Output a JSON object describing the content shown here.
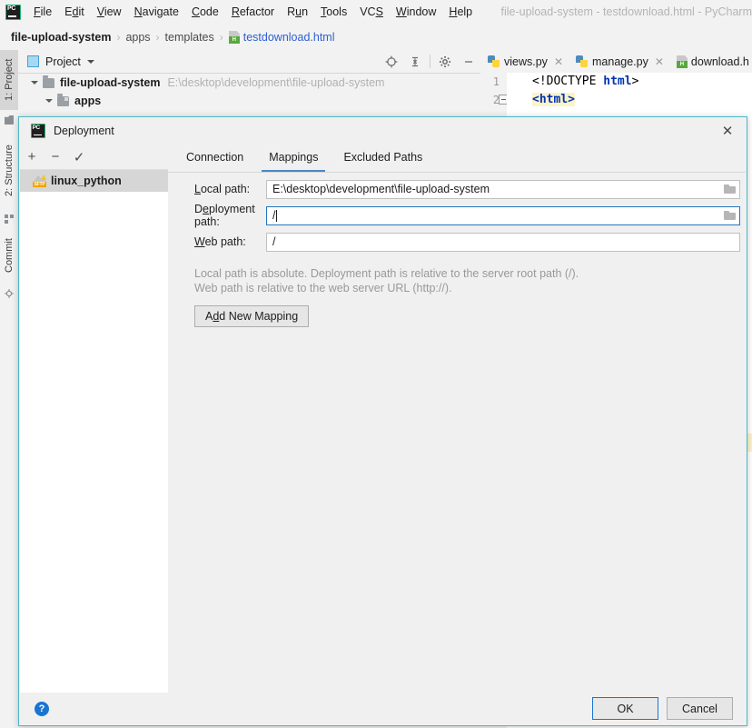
{
  "window": {
    "title": "file-upload-system - testdownload.html - PyCharm",
    "logo_icon": "pycharm-logo-icon"
  },
  "menu": {
    "items": [
      {
        "label": "File",
        "mnemonic": "F"
      },
      {
        "label": "Edit",
        "mnemonic": "E"
      },
      {
        "label": "View",
        "mnemonic": "V"
      },
      {
        "label": "Navigate",
        "mnemonic": "N"
      },
      {
        "label": "Code",
        "mnemonic": "C"
      },
      {
        "label": "Refactor",
        "mnemonic": "R"
      },
      {
        "label": "Run",
        "mnemonic": "u"
      },
      {
        "label": "Tools",
        "mnemonic": "T"
      },
      {
        "label": "VCS",
        "mnemonic": "S"
      },
      {
        "label": "Window",
        "mnemonic": "W"
      },
      {
        "label": "Help",
        "mnemonic": "H"
      }
    ]
  },
  "breadcrumb": {
    "separator": "›",
    "items": [
      {
        "label": "file-upload-system",
        "style": "bold"
      },
      {
        "label": "apps",
        "style": "plain"
      },
      {
        "label": "templates",
        "style": "plain"
      },
      {
        "label": "testdownload.html",
        "style": "link",
        "icon": "html-file-icon"
      }
    ]
  },
  "stripe": {
    "items": [
      {
        "label": "1: Project",
        "active": true
      },
      {
        "label": "2: Structure",
        "active": false
      },
      {
        "label": "Commit",
        "active": false
      }
    ]
  },
  "project_panel": {
    "title": "Project",
    "dropdown_icon": "chevron-down-icon",
    "toolbar_icons": [
      "locate-target-icon",
      "collapse-all-icon",
      "settings-gear-icon",
      "hide-minimize-icon"
    ],
    "tree": [
      {
        "label": "file-upload-system",
        "path": "E:\\desktop\\development\\file-upload-system",
        "indent": 0,
        "expanded": true
      },
      {
        "label": "apps",
        "path": "",
        "indent": 1,
        "expanded": true
      }
    ]
  },
  "editor": {
    "tabs": [
      {
        "label": "views.py",
        "icon": "python-file-icon",
        "close_icon": "close-icon"
      },
      {
        "label": "manage.py",
        "icon": "python-file-icon",
        "close_icon": "close-icon"
      },
      {
        "label": "download.h",
        "icon": "html-file-icon",
        "close_icon": ""
      }
    ],
    "lines": [
      {
        "num": "1",
        "text": "<!DOCTYPE html>"
      },
      {
        "num": "2",
        "text": "<html>"
      }
    ]
  },
  "dialog": {
    "title": "Deployment",
    "icon": "pycharm-logo-icon",
    "close_icon": "close-icon",
    "sidebar": {
      "toolbar": [
        {
          "name": "add-server-button",
          "glyph": "+"
        },
        {
          "name": "remove-server-button",
          "glyph": "−"
        },
        {
          "name": "set-default-server-button",
          "glyph": "✓"
        }
      ],
      "servers": [
        {
          "label": "linux_python",
          "icon": "sftp-server-icon",
          "selected": true
        }
      ]
    },
    "tabs": [
      {
        "label": "Connection",
        "active": false
      },
      {
        "label": "Mappings",
        "active": true
      },
      {
        "label": "Excluded Paths",
        "active": false
      }
    ],
    "fields": [
      {
        "name": "local-path",
        "label": "Local path:",
        "mnemonic": "L",
        "value": "E:\\desktop\\development\\file-upload-system",
        "focused": false,
        "has_browse": true,
        "browse_icon": "folder-browse-icon"
      },
      {
        "name": "deployment-path",
        "label": "Deployment path:",
        "mnemonic": "e",
        "value": "/",
        "focused": true,
        "has_browse": true,
        "browse_icon": "folder-browse-icon"
      },
      {
        "name": "web-path",
        "label": "Web path:",
        "mnemonic": "W",
        "value": "/",
        "focused": false,
        "has_browse": false,
        "browse_icon": ""
      }
    ],
    "hints": [
      "Local path is absolute. Deployment path is relative to the server root path (/).",
      "Web path is relative to the web server URL (http://)."
    ],
    "add_mapping_label": "Add New Mapping",
    "add_mapping_mnemonic": "d",
    "help_label": "?",
    "ok_label": "OK",
    "cancel_label": "Cancel"
  },
  "colors": {
    "dialog_border": "#4cb8c4",
    "accent_blue": "#1975d1",
    "tab_underline": "#4a88c7",
    "link": "#2f5fd0",
    "selection_gray": "#d6d6d6"
  }
}
